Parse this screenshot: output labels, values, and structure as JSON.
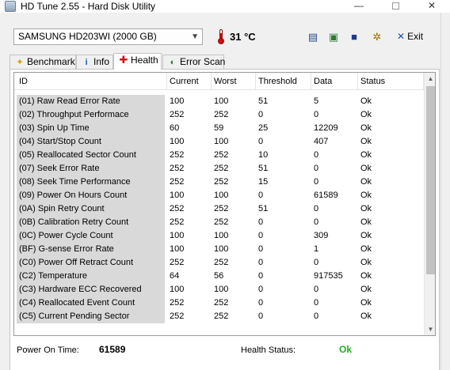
{
  "window": {
    "title": "HD Tune 2.55 - Hard Disk Utility",
    "min_glyph": "—",
    "close_glyph": "✕"
  },
  "toolbar": {
    "drive": "SAMSUNG HD203WI (2000 GB)",
    "temperature": "31 °C",
    "exit_label": "Exit",
    "icons": [
      "copy-text-icon",
      "copy-screenshot-icon",
      "save-icon",
      "options-icon",
      "exit-icon",
      "thermometer-icon"
    ]
  },
  "tabs": [
    {
      "label": "Benchmark",
      "icon": "benchmark-icon"
    },
    {
      "label": "Info",
      "icon": "info-icon"
    },
    {
      "label": "Health",
      "icon": "health-cross-icon",
      "active": true
    },
    {
      "label": "Error Scan",
      "icon": "error-scan-icon"
    }
  ],
  "table": {
    "columns": [
      "ID",
      "Current",
      "Worst",
      "Threshold",
      "Data",
      "Status"
    ],
    "rows": [
      {
        "id": "(01) Raw Read Error Rate",
        "current": "100",
        "worst": "100",
        "threshold": "51",
        "data": "5",
        "status": "Ok"
      },
      {
        "id": "(02) Throughput Performace",
        "current": "252",
        "worst": "252",
        "threshold": "0",
        "data": "0",
        "status": "Ok"
      },
      {
        "id": "(03) Spin Up Time",
        "current": "60",
        "worst": "59",
        "threshold": "25",
        "data": "12209",
        "status": "Ok"
      },
      {
        "id": "(04) Start/Stop Count",
        "current": "100",
        "worst": "100",
        "threshold": "0",
        "data": "407",
        "status": "Ok"
      },
      {
        "id": "(05) Reallocated Sector Count",
        "current": "252",
        "worst": "252",
        "threshold": "10",
        "data": "0",
        "status": "Ok"
      },
      {
        "id": "(07) Seek Error Rate",
        "current": "252",
        "worst": "252",
        "threshold": "51",
        "data": "0",
        "status": "Ok"
      },
      {
        "id": "(08) Seek Time Performance",
        "current": "252",
        "worst": "252",
        "threshold": "15",
        "data": "0",
        "status": "Ok"
      },
      {
        "id": "(09) Power On Hours Count",
        "current": "100",
        "worst": "100",
        "threshold": "0",
        "data": "61589",
        "status": "Ok"
      },
      {
        "id": "(0A) Spin Retry Count",
        "current": "252",
        "worst": "252",
        "threshold": "51",
        "data": "0",
        "status": "Ok"
      },
      {
        "id": "(0B) Calibration Retry Count",
        "current": "252",
        "worst": "252",
        "threshold": "0",
        "data": "0",
        "status": "Ok"
      },
      {
        "id": "(0C) Power Cycle Count",
        "current": "100",
        "worst": "100",
        "threshold": "0",
        "data": "309",
        "status": "Ok"
      },
      {
        "id": "(BF) G-sense Error Rate",
        "current": "100",
        "worst": "100",
        "threshold": "0",
        "data": "1",
        "status": "Ok"
      },
      {
        "id": "(C0) Power Off Retract Count",
        "current": "252",
        "worst": "252",
        "threshold": "0",
        "data": "0",
        "status": "Ok"
      },
      {
        "id": "(C2) Temperature",
        "current": "64",
        "worst": "56",
        "threshold": "0",
        "data": "917535",
        "status": "Ok"
      },
      {
        "id": "(C3) Hardware ECC Recovered",
        "current": "100",
        "worst": "100",
        "threshold": "0",
        "data": "0",
        "status": "Ok"
      },
      {
        "id": "(C4) Reallocated Event Count",
        "current": "252",
        "worst": "252",
        "threshold": "0",
        "data": "0",
        "status": "Ok"
      },
      {
        "id": "(C5) Current Pending Sector",
        "current": "252",
        "worst": "252",
        "threshold": "0",
        "data": "0",
        "status": "Ok"
      }
    ]
  },
  "footer": {
    "power_on_time_label": "Power On Time:",
    "power_on_time_value": "61589",
    "health_status_label": "Health Status:",
    "health_status_value": "Ok"
  },
  "colors": {
    "health_ok": "#22b022",
    "id_cell_background": "#d9d9d9",
    "temperature_icon": "#d01010"
  }
}
